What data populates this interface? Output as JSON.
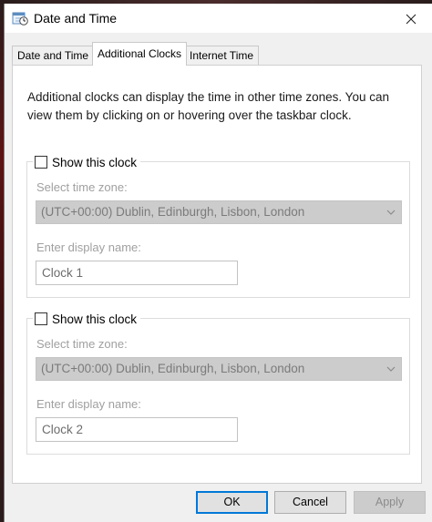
{
  "window": {
    "title": "Date and Time"
  },
  "tabs": [
    {
      "label": "Date and Time",
      "active": false
    },
    {
      "label": "Additional Clocks",
      "active": true
    },
    {
      "label": "Internet Time",
      "active": false
    }
  ],
  "panel": {
    "intro": "Additional clocks can display the time in other time zones. You can view them by clicking on or hovering over the taskbar clock."
  },
  "clocks": [
    {
      "show_label": "Show this clock",
      "checked": false,
      "timezone_label": "Select time zone:",
      "timezone_value": "(UTC+00:00) Dublin, Edinburgh, Lisbon, London",
      "name_label": "Enter display name:",
      "name_value": "Clock 1"
    },
    {
      "show_label": "Show this clock",
      "checked": false,
      "timezone_label": "Select time zone:",
      "timezone_value": "(UTC+00:00) Dublin, Edinburgh, Lisbon, London",
      "name_label": "Enter display name:",
      "name_value": "Clock 2"
    }
  ],
  "buttons": {
    "ok": "OK",
    "cancel": "Cancel",
    "apply": "Apply"
  },
  "icons": {
    "window_icon": "date-time-clock-icon",
    "close": "close-icon",
    "dropdown": "chevron-down-icon"
  },
  "colors": {
    "accent": "#0078d7",
    "disabled_text": "#a0a0a0",
    "disabled_fill": "#cccccc"
  }
}
